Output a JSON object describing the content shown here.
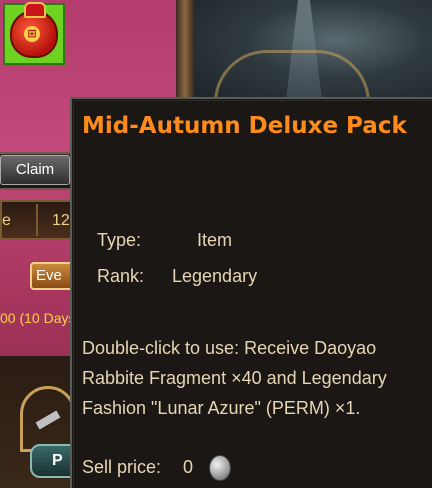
{
  "background": {
    "claim_label": "Claim",
    "row_left": "e",
    "row_right": "12",
    "even_label": "Eve",
    "days_text": "00 (10 Days",
    "bottom_button": "P",
    "item_seal": "⊞"
  },
  "tooltip": {
    "title": "Mid-Autumn Deluxe Pack",
    "type_label": "Type:",
    "type_value": "Item",
    "rank_label": "Rank:",
    "rank_value": "Legendary",
    "description": "Double-click to use: Receive Daoyao Rabbite Fragment ×40 and Legendary Fashion \"Lunar Azure\" (PERM) ×1.",
    "sell_label": "Sell price:",
    "sell_value": "0",
    "sell_icon": "silver-coin-icon",
    "title_color": "#ff8c1a",
    "text_color": "#e6d6b4"
  }
}
